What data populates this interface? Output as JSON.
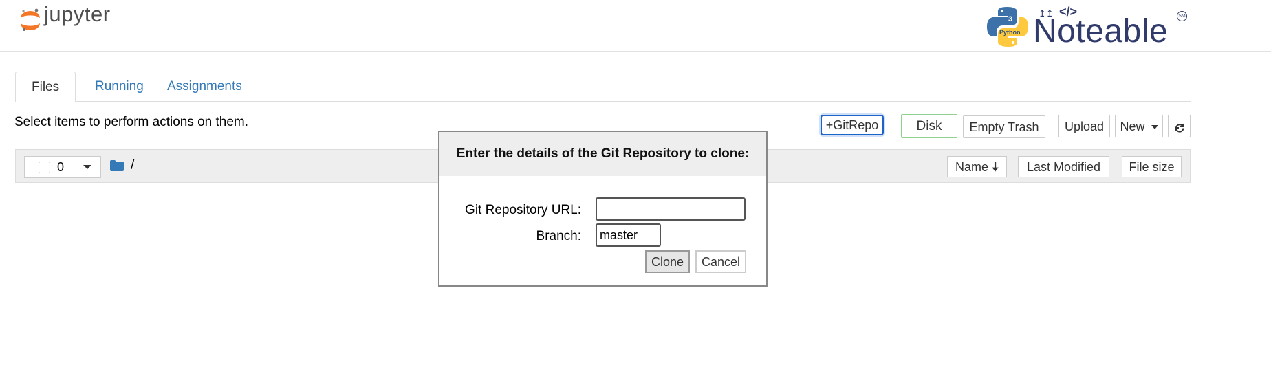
{
  "header": {
    "jupyter_logo_text": "jupyter",
    "noteable_logo_text": "Noteable",
    "noteable_sm": "SM",
    "python_badge": "Python",
    "python_version": "3"
  },
  "tabs": [
    {
      "label": "Files",
      "active": true
    },
    {
      "label": "Running",
      "active": false
    },
    {
      "label": "Assignments",
      "active": false
    }
  ],
  "hint_text": "Select items to perform actions on them.",
  "toolbar": {
    "gitrepo_label": "+GitRepo",
    "disk_label": "Disk",
    "empty_trash_label": "Empty Trash",
    "upload_label": "Upload",
    "new_label": "New",
    "refresh_icon": "refresh-icon"
  },
  "list_header": {
    "selected_count": "0",
    "path": "/",
    "sort_name_label": "Name",
    "last_modified_label": "Last Modified",
    "file_size_label": "File size"
  },
  "dialog": {
    "title": "Enter the details of the Git Repository to clone:",
    "url_label": "Git Repository URL:",
    "url_value": "",
    "branch_label": "Branch:",
    "branch_value": "master",
    "clone_label": "Clone",
    "cancel_label": "Cancel"
  },
  "colors": {
    "link_blue": "#337ab7",
    "focus_blue": "#1e64c8",
    "disk_border_green": "#8fd28f",
    "jupyter_orange": "#f37726",
    "noteable_navy": "#303a6b"
  }
}
